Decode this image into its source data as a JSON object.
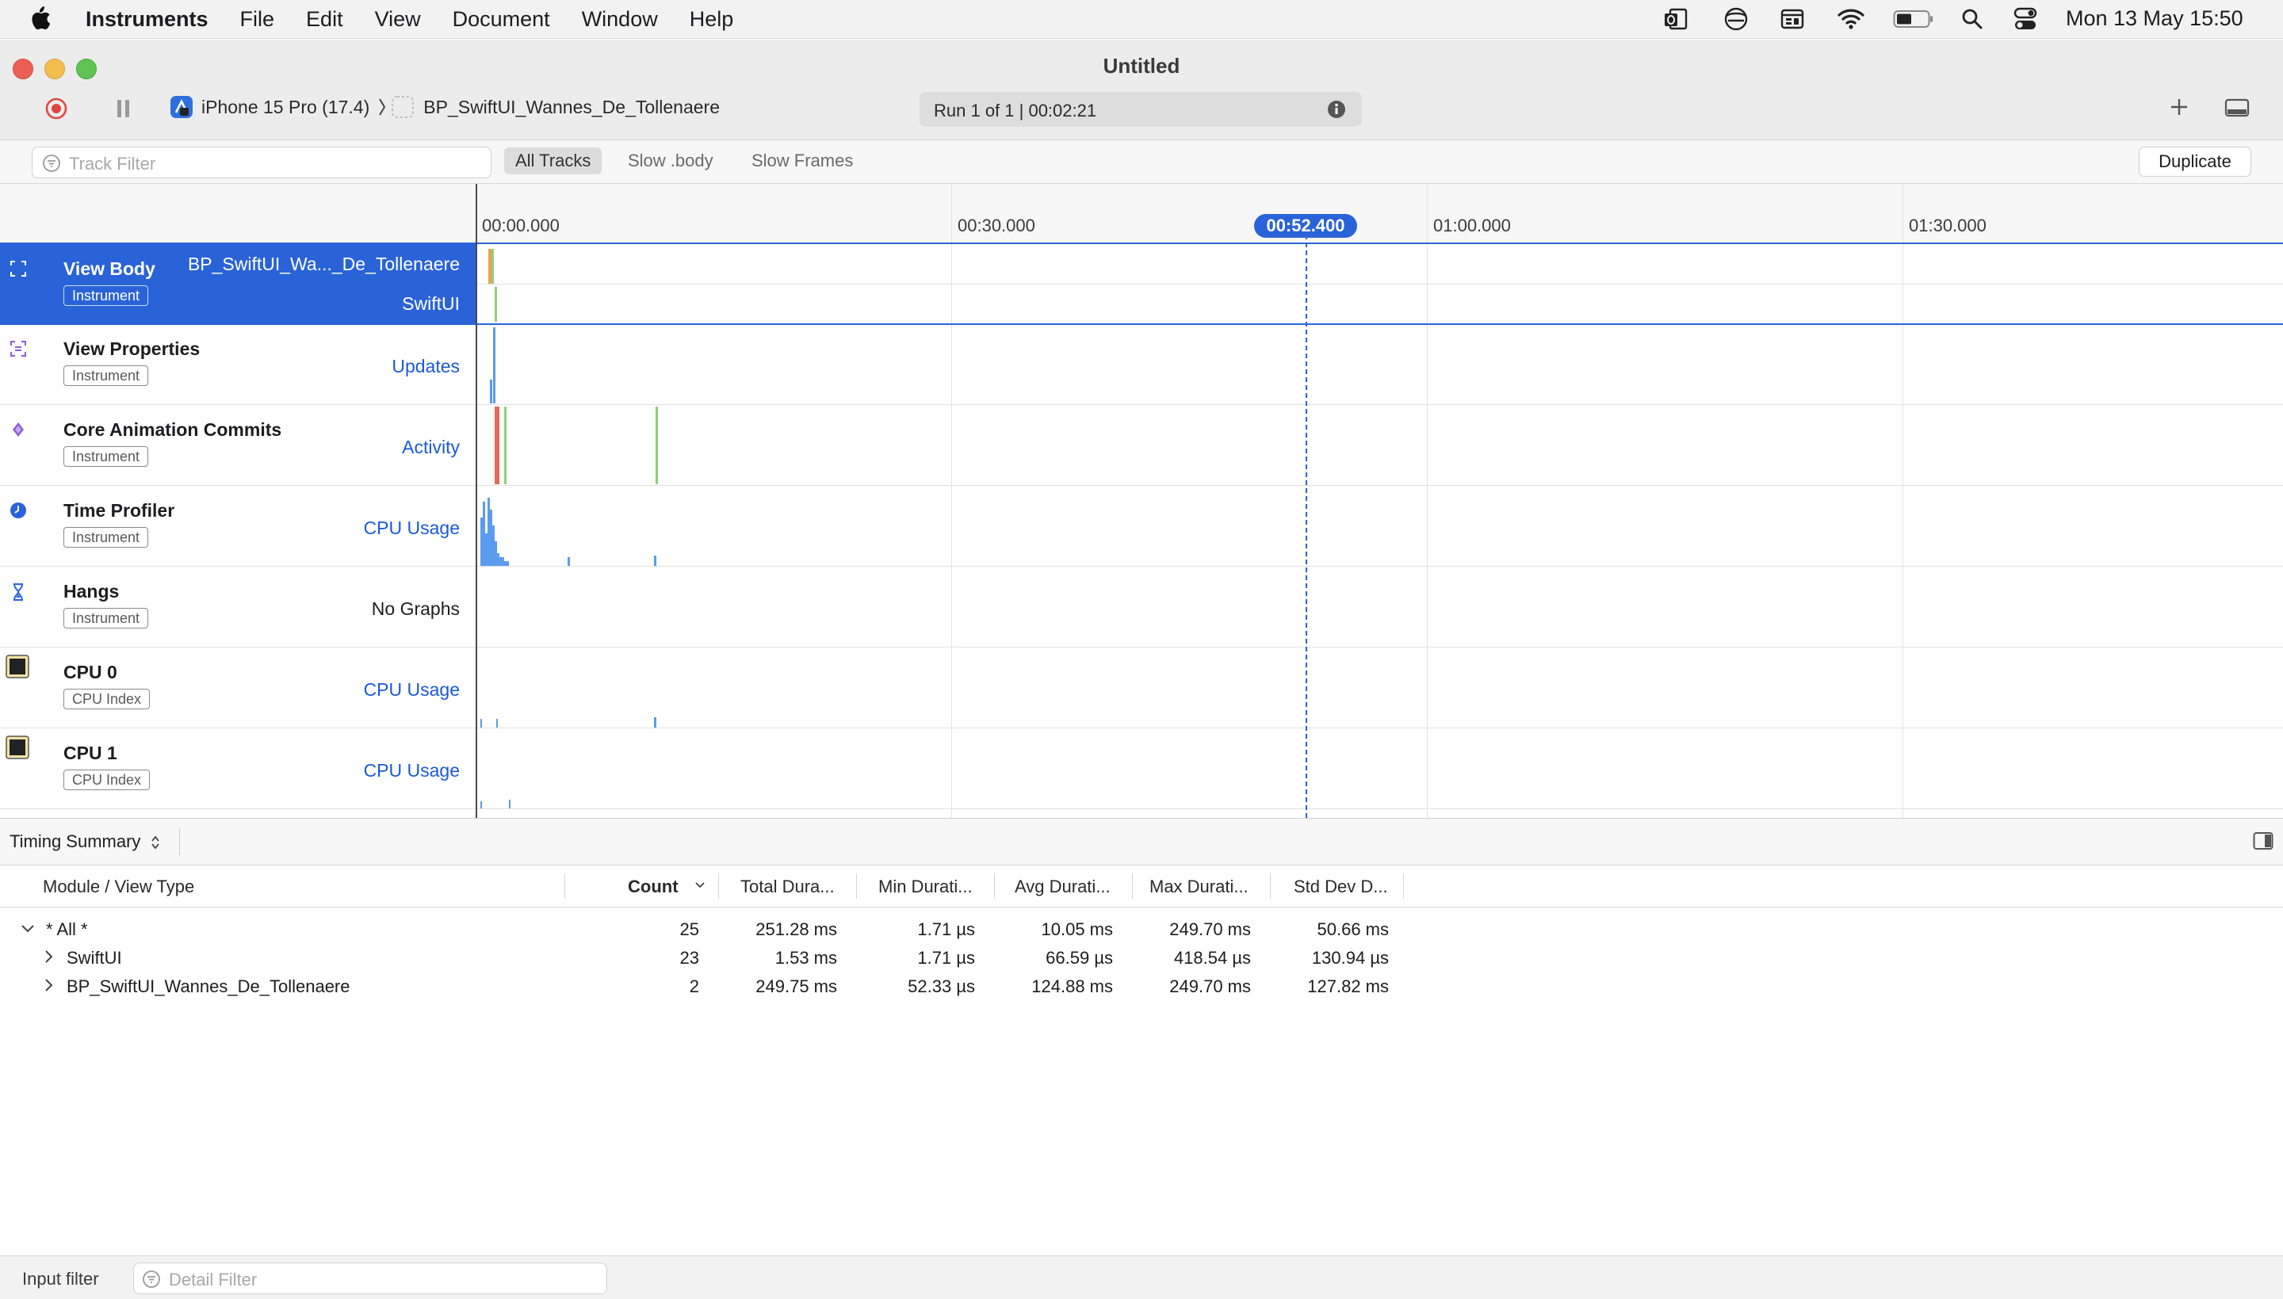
{
  "menubar": {
    "app_name": "Instruments",
    "menus": [
      "File",
      "Edit",
      "View",
      "Document",
      "Window",
      "Help"
    ],
    "clock": "Mon 13 May  15:50",
    "status_icons": [
      "outlook-icon",
      "copilot-icon",
      "screen-icon",
      "wifi-icon",
      "battery-icon",
      "search-icon",
      "control-center-icon"
    ]
  },
  "window": {
    "title": "Untitled",
    "device": "iPhone 15 Pro (17.4)",
    "target": "BP_SwiftUI_Wannes_De_Tollenaere",
    "run_status": "Run 1 of 1  |  00:02:21"
  },
  "filter_bar": {
    "placeholder": "Track Filter",
    "scopes": [
      "All Tracks",
      "Slow .body",
      "Slow Frames"
    ],
    "active_scope": "All Tracks",
    "duplicate_label": "Duplicate"
  },
  "timeline": {
    "ticks": [
      "00:00.000",
      "00:30.000",
      "01:00.000",
      "01:30.000"
    ],
    "playhead": "00:52.400",
    "tracks": [
      {
        "name": "View Body",
        "badge": "Instrument",
        "graph": "BP_SwiftUI_Wa..._De_Tollenaere",
        "graph2": "SwiftUI",
        "icon": "view-body-icon",
        "selected": true
      },
      {
        "name": "View Properties",
        "badge": "Instrument",
        "graph": "Updates",
        "icon": "view-properties-icon"
      },
      {
        "name": "Core Animation Commits",
        "badge": "Instrument",
        "graph": "Activity",
        "icon": "core-animation-icon"
      },
      {
        "name": "Time Profiler",
        "badge": "Instrument",
        "graph": "CPU Usage",
        "icon": "time-profiler-icon"
      },
      {
        "name": "Hangs",
        "badge": "Instrument",
        "graph": "No Graphs",
        "icon": "hourglass-icon"
      },
      {
        "name": "CPU 0",
        "badge": "CPU Index",
        "graph": "CPU Usage",
        "icon": "cpu-icon"
      },
      {
        "name": "CPU 1",
        "badge": "CPU Index",
        "graph": "CPU Usage",
        "icon": "cpu-icon"
      }
    ]
  },
  "detail": {
    "view_selector": "Timing Summary",
    "columns": [
      "Module / View Type",
      "Count",
      "Total Dura...",
      "Min Durati...",
      "Avg Durati...",
      "Max Durati...",
      "Std Dev D..."
    ],
    "rows": [
      {
        "name": "* All *",
        "expanded": true,
        "count": "25",
        "total": "251.28 ms",
        "min": "1.71 µs",
        "avg": "10.05 ms",
        "max": "249.70 ms",
        "std": "50.66 ms"
      },
      {
        "name": "SwiftUI",
        "expanded": false,
        "count": "23",
        "total": "1.53 ms",
        "min": "1.71 µs",
        "avg": "66.59 µs",
        "max": "418.54 µs",
        "std": "130.94 µs"
      },
      {
        "name": "BP_SwiftUI_Wannes_De_Tollenaere",
        "expanded": false,
        "count": "2",
        "total": "249.75 ms",
        "min": "52.33 µs",
        "avg": "124.88 ms",
        "max": "249.70 ms",
        "std": "127.82 ms"
      }
    ]
  },
  "bottom_bar": {
    "label": "Input filter",
    "placeholder": "Detail Filter"
  },
  "colors": {
    "accent": "#2a63d8",
    "track_link": "#1a5ad8",
    "graph_blue": "#5b9bf0",
    "graph_green": "#8fd17a",
    "graph_orange": "#f0a050",
    "graph_red": "#e36b5c"
  }
}
